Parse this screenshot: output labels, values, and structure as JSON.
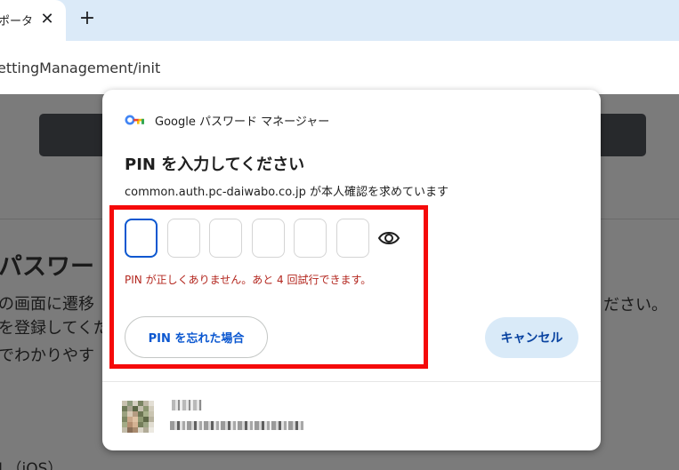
{
  "browser": {
    "tab_title": "ポータ",
    "close_label": "✕",
    "new_tab_label": "+",
    "url": "ettingManagement/init"
  },
  "background_page": {
    "heading": "パスワー",
    "line1": "の画面に遷移",
    "line2": "を登録してくだ",
    "line3": "でわかりやす",
    "line_right": "ださい。",
    "line_bottom": "L（iOS）"
  },
  "dialog": {
    "brand": "Google パスワード マネージャー",
    "title": "PIN を入力してください",
    "subtitle": "common.auth.pc-daiwabo.co.jp が本人確認を求めています",
    "pin_boxes": [
      "",
      "",
      "",
      "",
      "",
      ""
    ],
    "error": "PIN が正しくありません。あと 4 回試行できます。",
    "forgot_label": "PIN を忘れた場合",
    "cancel_label": "キャンセル",
    "account": {
      "name": "■ ■ ■",
      "email": "■■■■■■■■■■■■■■■■"
    }
  },
  "icons": {
    "key": "key-icon",
    "eye": "eye-icon",
    "avatar": "avatar"
  },
  "colors": {
    "accent": "#0b57d0",
    "error": "#b3261e",
    "highlight": "#f50a0a",
    "tabstrip": "#dbeaf8",
    "cancel_bg": "#d9eaf8"
  }
}
